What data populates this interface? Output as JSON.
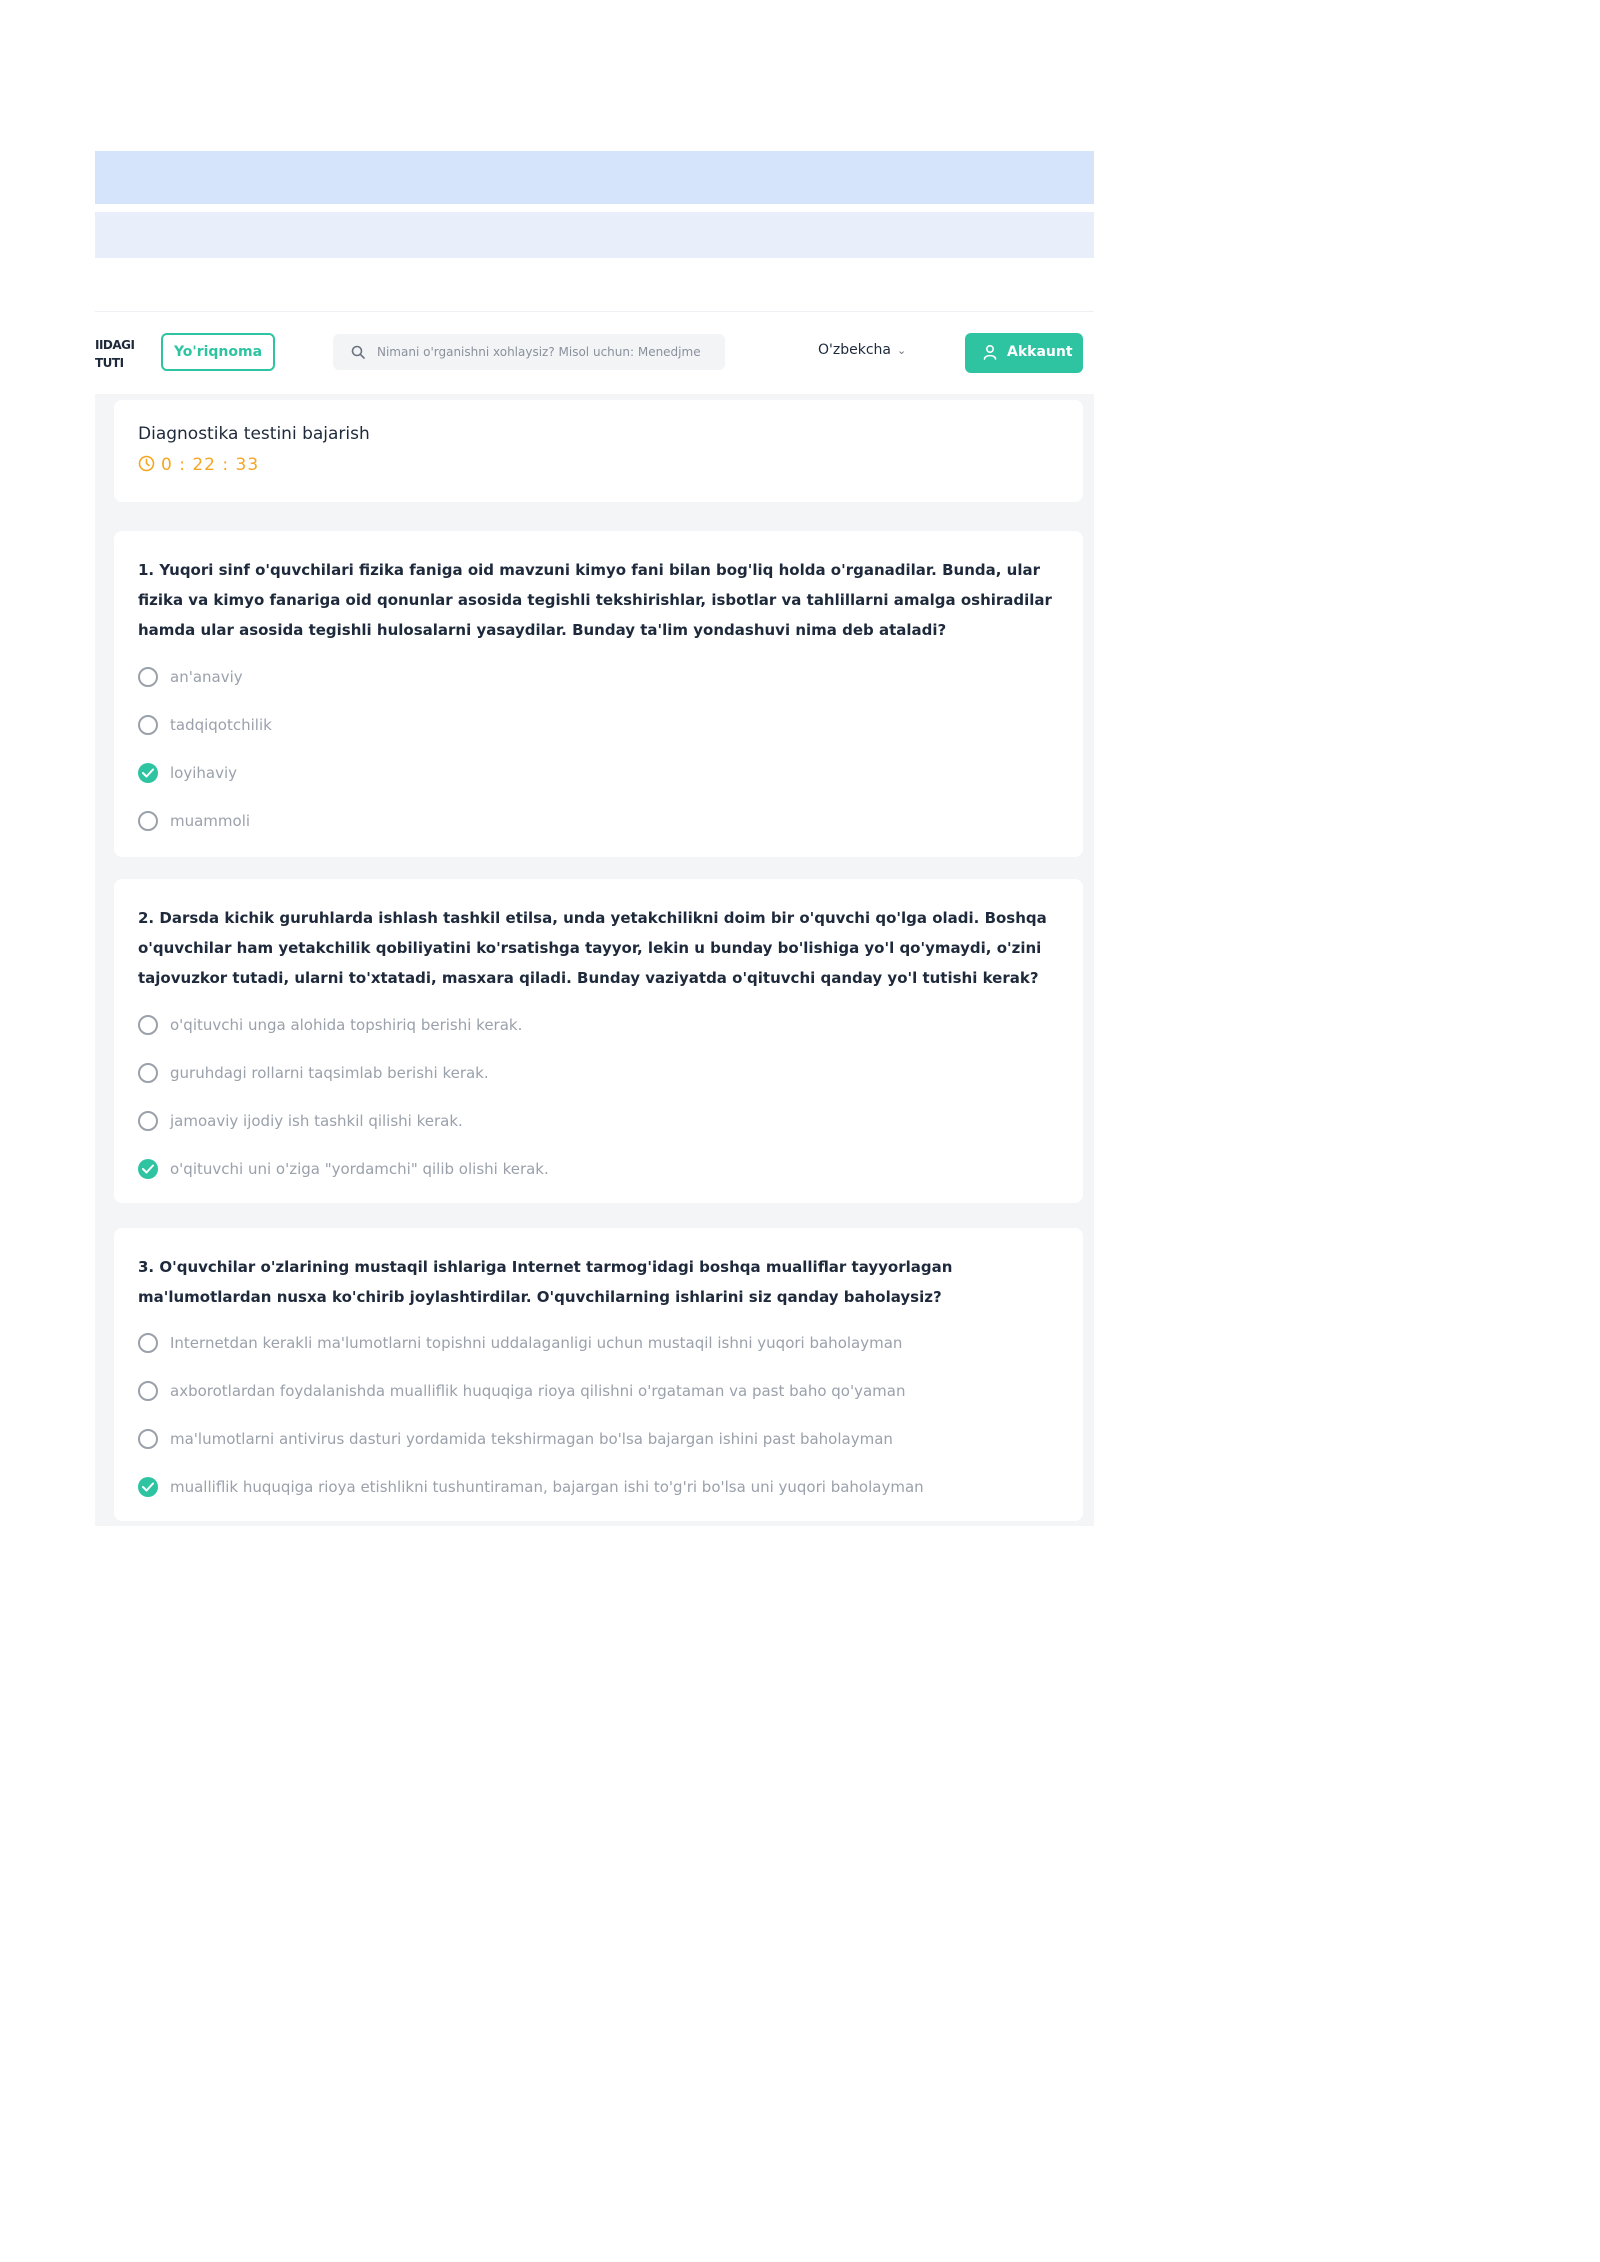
{
  "header": {
    "logo_line1": "IIDAGI",
    "logo_line2": "TUTI",
    "guide_label": "Yo'riqnoma",
    "search_placeholder": "Nimani o'rganishni xohlaysiz? Misol uchun: Menedjme",
    "language": "O'zbekcha",
    "account_label": "Akkaunt"
  },
  "test": {
    "title": "Diagnostika testini bajarish",
    "timer": "0 : 22 : 33"
  },
  "questions": [
    {
      "number": "1.",
      "text": "Yuqori sinf o'quvchilari fizika faniga oid mavzuni kimyo fani bilan bog'liq holda o'rganadilar. Bunda, ular fizika va kimyo fanariga oid qonunlar asosida tegishli tekshirishlar, isbotlar va tahlillarni amalga oshiradilar hamda ular asosida tegishli hulosalarni yasaydilar. Bunday ta'lim yondashuvi nima deb ataladi?",
      "options": [
        {
          "label": "an'anaviy",
          "selected": false
        },
        {
          "label": "tadqiqotchilik",
          "selected": false
        },
        {
          "label": "loyihaviy",
          "selected": true
        },
        {
          "label": "muammoli",
          "selected": false
        }
      ]
    },
    {
      "number": "2.",
      "text": "Darsda kichik guruhlarda ishlash tashkil etilsa, unda yetakchilikni doim bir o'quvchi qo'lga oladi. Boshqa o'quvchilar ham yetakchilik qobiliyatini ko'rsatishga tayyor, lekin u bunday bo'lishiga yo'l qo'ymaydi, o'zini tajovuzkor tutadi, ularni to'xtatadi, masxara qiladi. Bunday vaziyatda o'qituvchi qanday yo'l tutishi kerak?",
      "options": [
        {
          "label": "o'qituvchi unga alohida topshiriq berishi kerak.",
          "selected": false
        },
        {
          "label": "guruhdagi rollarni taqsimlab berishi kerak.",
          "selected": false
        },
        {
          "label": "jamoaviy ijodiy ish tashkil qilishi kerak.",
          "selected": false
        },
        {
          "label": "o'qituvchi uni o'ziga \"yordamchi\" qilib olishi kerak.",
          "selected": true
        }
      ]
    },
    {
      "number": "3.",
      "text": "O'quvchilar o'zlarining mustaqil ishlariga Internet tarmog'idagi boshqa mualliflar tayyorlagan ma'lumotlardan nusxa ko'chirib joylashtirdilar. O'quvchilarning ishlarini siz qanday baholaysiz?",
      "options": [
        {
          "label": "Internetdan kerakli ma'lumotlarni topishni uddalaganligi uchun mustaqil ishni yuqori baholayman",
          "selected": false
        },
        {
          "label": "axborotlardan foydalanishda mualliflik huquqiga rioya qilishni o'rgataman va past baho qo'yaman",
          "selected": false
        },
        {
          "label": "ma'lumotlarni antivirus dasturi yordamida tekshirmagan bo'lsa bajargan ishini past baholayman",
          "selected": false
        },
        {
          "label": "mualliflik huquqiga rioya etishlikni tushuntiraman, bajargan ishi to'g'ri bo'lsa uni yuqori baholayman",
          "selected": true
        }
      ]
    }
  ],
  "colors": {
    "accent": "#2ec4a2",
    "timer": "#f5a623",
    "text_dark": "#1e2a3b",
    "text_muted": "#9aa1ab"
  }
}
